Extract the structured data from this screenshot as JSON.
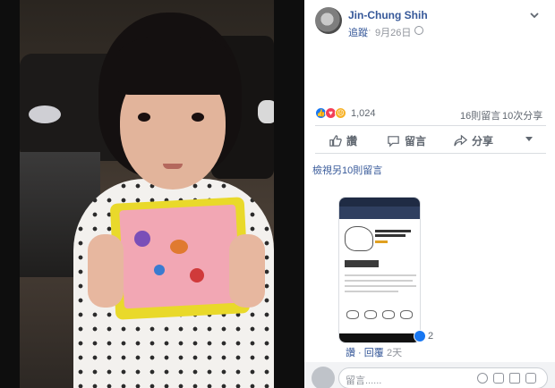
{
  "post": {
    "author": "Jin-Chung Shih",
    "follow": "追蹤",
    "separator": "·",
    "date": "9月26日",
    "reaction_count": "1,024",
    "comments": "16則留言",
    "shares": "10次分享"
  },
  "actions": {
    "like": "讚",
    "comment": "留言",
    "share": "分享"
  },
  "comments": {
    "view_more": "檢視另10則留言",
    "like_count": "2",
    "reply": "讚 · 回覆",
    "time": "2天"
  },
  "composer": {
    "placeholder": "留言......"
  },
  "icons": {
    "reactions": [
      "like-icon",
      "love-icon",
      "sad-icon"
    ],
    "composer": [
      "emoji-icon",
      "camera-icon",
      "gif-icon",
      "sticker-icon"
    ]
  },
  "colors": {
    "link": "#365899",
    "like_blue": "#1877f2",
    "love_red": "#f33e58",
    "sad_yellow": "#f7b125"
  }
}
